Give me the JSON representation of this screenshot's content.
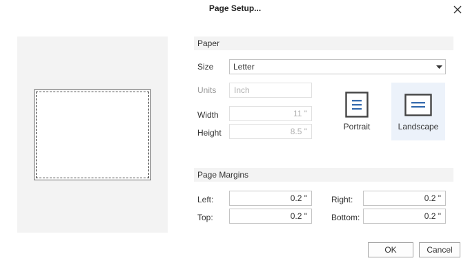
{
  "dialog": {
    "title": "Page Setup...",
    "close_icon": "close-icon"
  },
  "paper": {
    "header": "Paper",
    "size_label": "Size",
    "size_value": "Letter",
    "units_label": "Units",
    "units_value": "Inch",
    "width_label": "Width",
    "width_value": "11 \"",
    "height_label": "Height",
    "height_value": "8.5 \""
  },
  "orientation": {
    "portrait_label": "Portrait",
    "landscape_label": "Landscape",
    "selected": "landscape",
    "selected_bg": "#ecf2fa",
    "icon_color": "#3b6fb0"
  },
  "margins": {
    "header": "Page Margins",
    "left_label": "Left:",
    "left_value": "0.2 \"",
    "top_label": "Top:",
    "top_value": "0.2 \"",
    "right_label": "Right:",
    "right_value": "0.2 \"",
    "bottom_label": "Bottom:",
    "bottom_value": "0.2 \""
  },
  "buttons": {
    "ok": "OK",
    "cancel": "Cancel"
  }
}
